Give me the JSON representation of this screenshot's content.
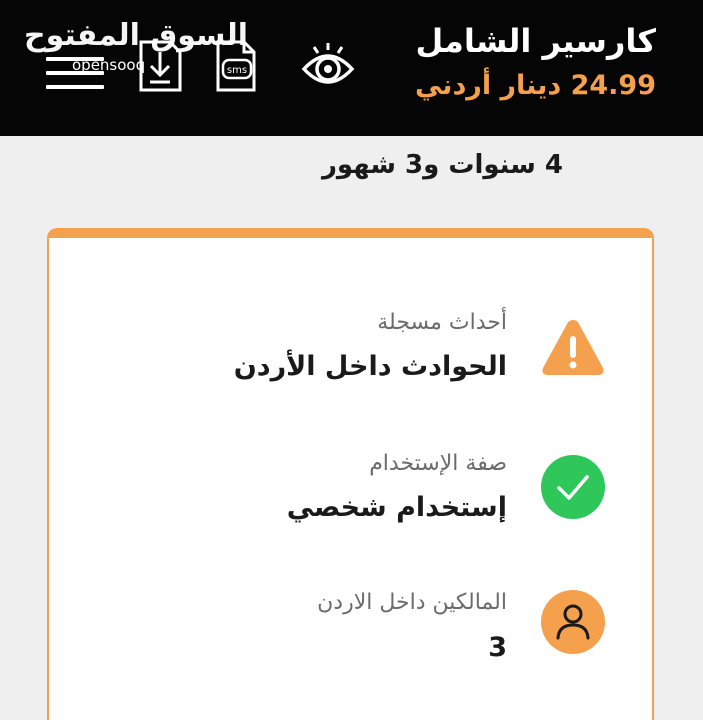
{
  "header": {
    "title": "كارسير الشامل",
    "price": "24.99 دينار أردني",
    "watermark_brand_ar": "السوق المفتوح",
    "watermark_brand_en": "opensooq",
    "sms_icon_text": "sms"
  },
  "summary": {
    "duration": "4 سنوات و3 شهور"
  },
  "card": {
    "rows": [
      {
        "icon": "warning-icon",
        "label": "أحداث مسجلة",
        "value": "الحوادث داخل الأردن"
      },
      {
        "icon": "check-circle-icon",
        "label": "صفة الإستخدام",
        "value": "إستخدام شخصي"
      },
      {
        "icon": "person-icon",
        "label": "المالكين داخل الاردن",
        "value": "3"
      }
    ]
  },
  "colors": {
    "accent": "#f5a04c",
    "check": "#2fc65a",
    "topbar": "#050505",
    "background": "#efefef"
  }
}
